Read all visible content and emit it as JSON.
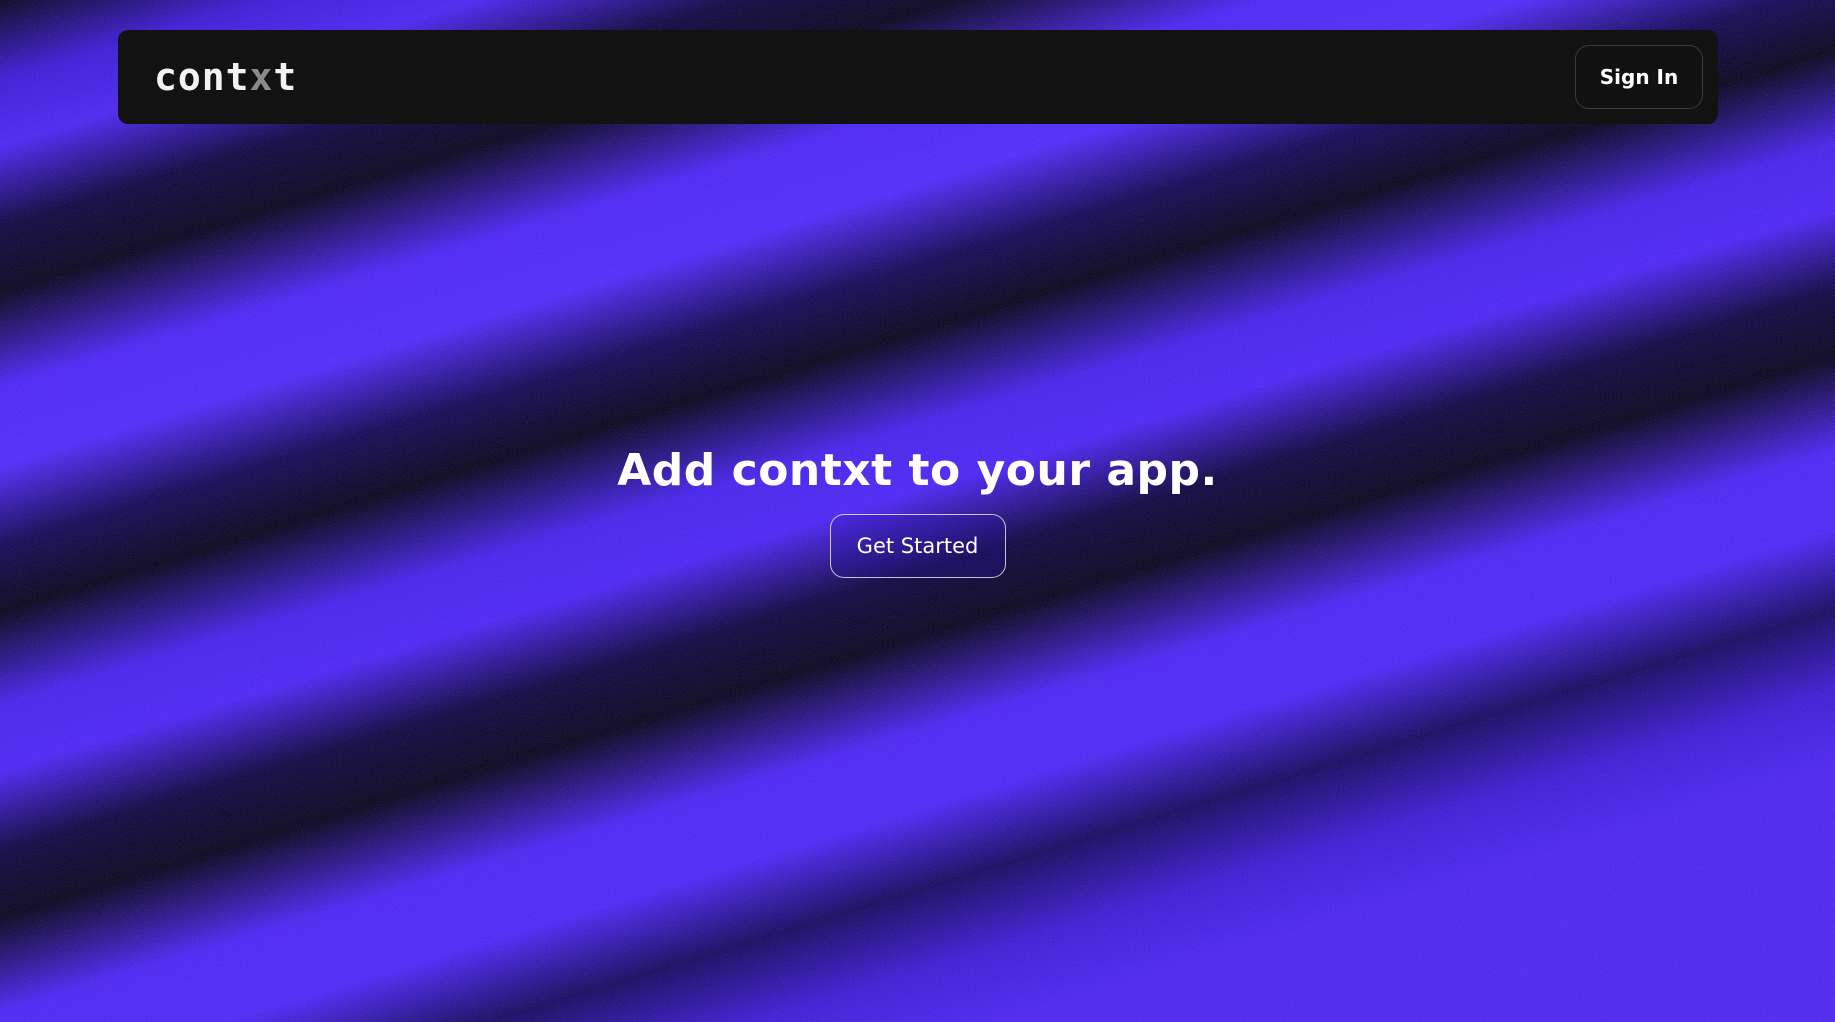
{
  "colors": {
    "background_purple": "#4a21f5",
    "background_dark": "#06011f",
    "navbar_bg": "#121212",
    "text": "#ffffff"
  },
  "navbar": {
    "logo": {
      "part1": "cont",
      "part2": "x",
      "part3": "t"
    },
    "signin_label": "Sign In"
  },
  "hero": {
    "headline": "Add contxt to your app.",
    "cta_label": "Get Started"
  }
}
